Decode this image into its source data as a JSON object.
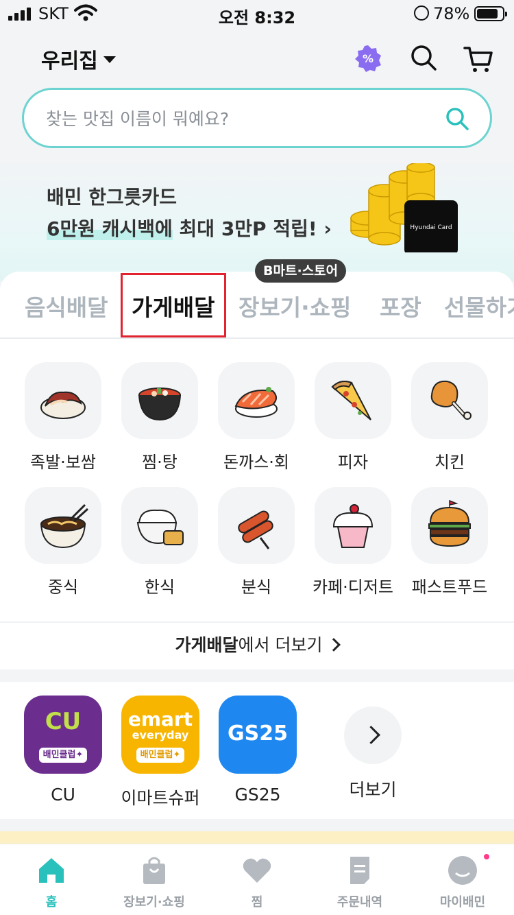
{
  "status_bar": {
    "carrier": "SKT",
    "time": "오전 8:32",
    "battery": "78%"
  },
  "header": {
    "address": "우리집",
    "icons": [
      "coupon-icon",
      "search-icon",
      "cart-icon"
    ]
  },
  "search": {
    "placeholder": "찾는 맛집 이름이 뭐예요?"
  },
  "promo": {
    "line1": "배민 한그릇카드",
    "line2_highlight": "6만원 캐시백에",
    "line2_rest": " 최대 3만P 적립! ",
    "card_text": "Hyundai Card"
  },
  "tabs": {
    "items": [
      {
        "label": "음식배달",
        "active": false
      },
      {
        "label": "가게배달",
        "active": true
      },
      {
        "label": "장보기·쇼핑",
        "active": false
      },
      {
        "label": "포장",
        "active": false
      },
      {
        "label": "선물하기",
        "active": false
      }
    ],
    "badge": "B마트·스토어"
  },
  "categories": [
    {
      "label": "족발·보쌈",
      "icon": "jokbal-icon"
    },
    {
      "label": "찜·탕",
      "icon": "stew-icon"
    },
    {
      "label": "돈까스·회",
      "icon": "sushi-icon"
    },
    {
      "label": "피자",
      "icon": "pizza-icon"
    },
    {
      "label": "치킨",
      "icon": "chicken-icon"
    },
    {
      "label": "중식",
      "icon": "noodle-icon"
    },
    {
      "label": "한식",
      "icon": "rice-icon"
    },
    {
      "label": "분식",
      "icon": "sausage-icon"
    },
    {
      "label": "카페·디저트",
      "icon": "cupcake-icon"
    },
    {
      "label": "패스트푸드",
      "icon": "burger-icon"
    }
  ],
  "more": {
    "bold": "가게배달",
    "rest": "에서 더보기"
  },
  "stores": [
    {
      "name": "CU",
      "brand": "CU",
      "club": "배민클럽✦",
      "color": "#6b2e8f"
    },
    {
      "name": "이마트슈퍼",
      "brand": "emart",
      "sub": "everyday",
      "club": "배민클럽✦",
      "color": "#f7b500"
    },
    {
      "name": "GS25",
      "brand": "GS25",
      "color": "#1e88f0"
    },
    {
      "name": "더보기"
    }
  ],
  "bottom_nav": [
    {
      "label": "홈",
      "icon": "home-icon",
      "active": true
    },
    {
      "label": "장보기·쇼핑",
      "icon": "shopping-bag-icon",
      "active": false
    },
    {
      "label": "찜",
      "icon": "heart-icon",
      "active": false
    },
    {
      "label": "주문내역",
      "icon": "receipt-icon",
      "active": false
    },
    {
      "label": "마이배민",
      "icon": "profile-icon",
      "active": false
    }
  ],
  "colors": {
    "accent": "#2ac1bc",
    "search_border": "#6dd3d0",
    "highlight_box": "#e0232e"
  }
}
